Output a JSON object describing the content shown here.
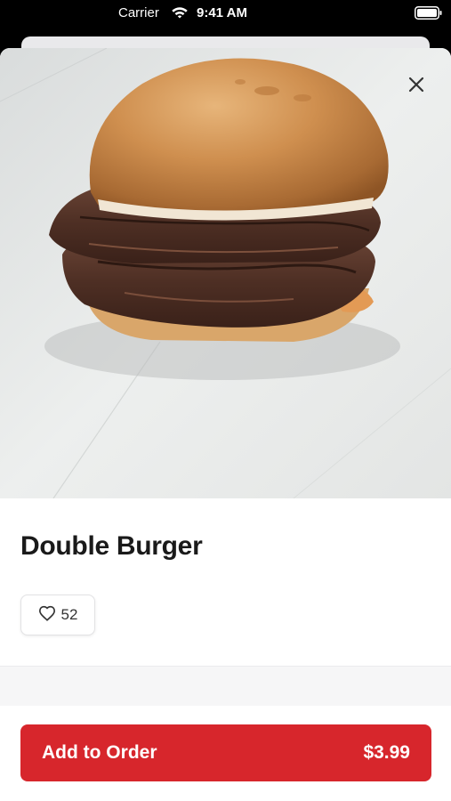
{
  "status_bar": {
    "carrier": "Carrier",
    "time": "9:41 AM",
    "icons": [
      "wifi-icon",
      "battery-icon"
    ]
  },
  "item": {
    "name": "Double Burger",
    "likes": "52",
    "image": "burger-photo"
  },
  "actions": {
    "close_icon": "close-icon",
    "like_icon": "heart-icon",
    "add_label": "Add to Order",
    "price": "$3.99"
  },
  "colors": {
    "accent": "#d7262c",
    "title": "#1a1a1a"
  }
}
